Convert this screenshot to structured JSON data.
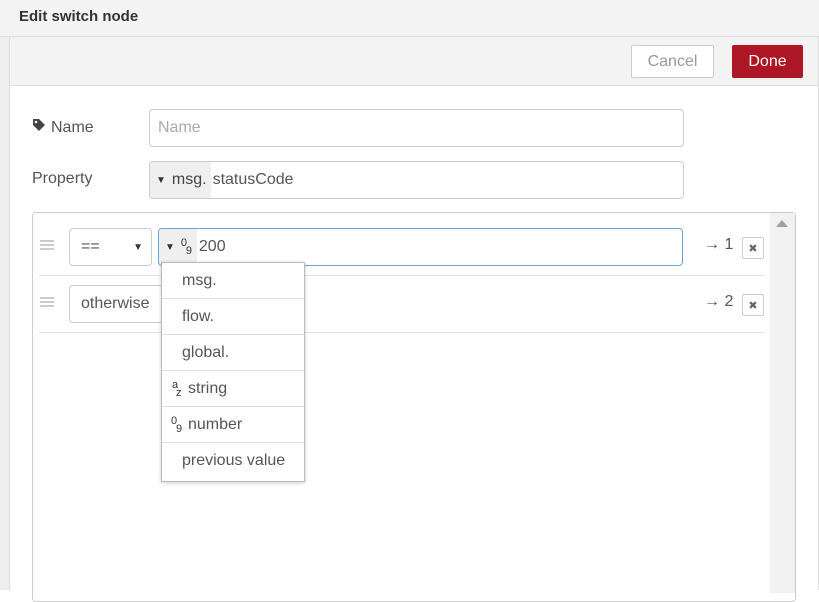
{
  "dialog": {
    "title": "Edit switch node"
  },
  "buttons": {
    "cancel": "Cancel",
    "done": "Done"
  },
  "form": {
    "name_label": "Name",
    "name_placeholder": "Name",
    "name_value": "",
    "property_label": "Property",
    "property_type": "msg.",
    "property_value": "statusCode"
  },
  "rules": [
    {
      "operator": "==",
      "value_type_icon": "number-icon",
      "value": "200",
      "output": "→ 1"
    },
    {
      "operator": "otherwise",
      "output": "→ 2"
    }
  ],
  "type_menu": {
    "items": [
      {
        "label": "msg."
      },
      {
        "label": "flow."
      },
      {
        "label": "global."
      },
      {
        "label": "string",
        "icon": "string-icon"
      },
      {
        "label": "number",
        "icon": "number-icon"
      },
      {
        "label": "previous value"
      }
    ]
  },
  "colors": {
    "done_button": "#ad1625",
    "focus_border": "#6aa5d8"
  }
}
